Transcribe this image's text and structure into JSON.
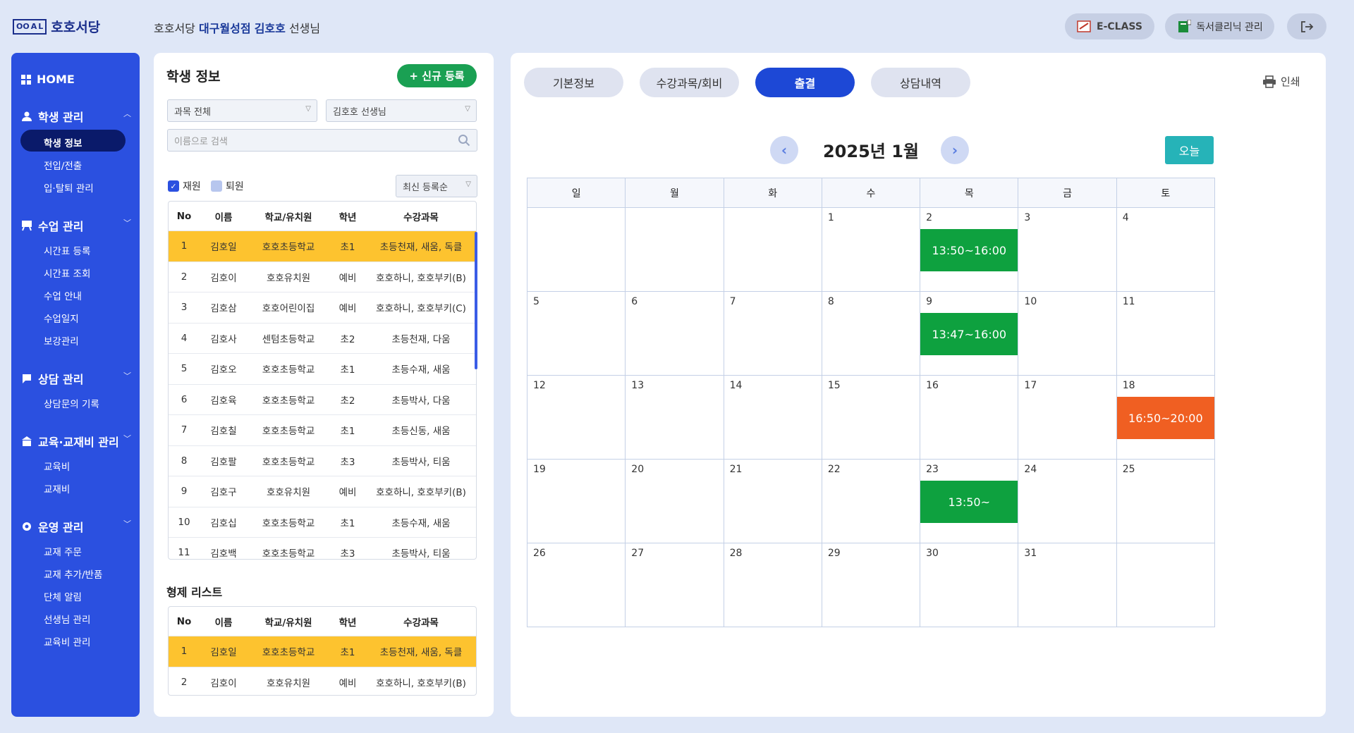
{
  "brand": {
    "mark": [
      "OO",
      "A",
      "L"
    ],
    "name": "호호서당"
  },
  "header": {
    "prefix": "호호서당",
    "branch": "대구월성점",
    "teacher": "김호호",
    "suffix": "선생님"
  },
  "header_buttons": [
    {
      "label": "E-CLASS",
      "icon": "eclass-icon"
    },
    {
      "label": "독서클리닉 관리",
      "icon": "book-icon"
    },
    {
      "label": "",
      "icon": "logout-icon"
    }
  ],
  "sidebar": {
    "home": "HOME",
    "sections": [
      {
        "label": "학생 관리",
        "icon": "person-icon",
        "expanded": true,
        "items": [
          "학생 정보",
          "전입/전출",
          "입·탈퇴 관리"
        ],
        "active": 0
      },
      {
        "label": "수업 관리",
        "icon": "easel-icon",
        "expanded": false,
        "items": [
          "시간표 등록",
          "시간표 조회",
          "수업 안내",
          "수업일지",
          "보강관리"
        ]
      },
      {
        "label": "상담 관리",
        "icon": "chat-icon",
        "expanded": false,
        "items": [
          "상담문의 기록"
        ]
      },
      {
        "label": "교육·교재비 관리",
        "icon": "school-icon",
        "expanded": false,
        "items": [
          "교육비",
          "교재비"
        ]
      },
      {
        "label": "운영 관리",
        "icon": "gear-icon",
        "expanded": false,
        "items": [
          "교재 주문",
          "교재 추가/반품",
          "단체 알림",
          "선생님 관리",
          "교육비 관리"
        ]
      }
    ]
  },
  "student_panel": {
    "title": "학생 정보",
    "new_button": "+ 신규 등록",
    "filter_subject": "과목 전체",
    "filter_teacher": "김호호 선생님",
    "search_placeholder": "이름으로 검색",
    "check_enrolled": "재원",
    "check_withdrawn": "퇴원",
    "sort": "최신 등록순",
    "columns": [
      "No",
      "이름",
      "학교/유치원",
      "학년",
      "수강과목"
    ],
    "rows": [
      [
        "1",
        "김호일",
        "호호초등학교",
        "초1",
        "초등천재, 새움, 독클"
      ],
      [
        "2",
        "김호이",
        "호호유치원",
        "예비",
        "호호하니, 호호부키(B)"
      ],
      [
        "3",
        "김호삼",
        "호호어린이집",
        "예비",
        "호호하니, 호호부키(C)"
      ],
      [
        "4",
        "김호사",
        "센텀초등학교",
        "초2",
        "초등천재, 다움"
      ],
      [
        "5",
        "김호오",
        "호호초등학교",
        "초1",
        "초등수재, 새움"
      ],
      [
        "6",
        "김호육",
        "호호초등학교",
        "초2",
        "초등박사, 다움"
      ],
      [
        "7",
        "김호칠",
        "호호초등학교",
        "초1",
        "초등신동, 새움"
      ],
      [
        "8",
        "김호팔",
        "호호초등학교",
        "초3",
        "초등박사, 티움"
      ],
      [
        "9",
        "김호구",
        "호호유치원",
        "예비",
        "호호하니, 호호부키(B)"
      ],
      [
        "10",
        "김호십",
        "호호초등학교",
        "초1",
        "초등수재, 새움"
      ],
      [
        "11",
        "김호백",
        "호호초등학교",
        "초3",
        "초등박사, 티움"
      ]
    ],
    "selected_row": 0,
    "siblings_title": "형제 리스트",
    "sibling_rows": [
      [
        "1",
        "김호일",
        "호호초등학교",
        "초1",
        "초등천재, 새움, 독클"
      ],
      [
        "2",
        "김호이",
        "호호유치원",
        "예비",
        "호호하니, 호호부키(B)"
      ]
    ]
  },
  "tabs": [
    "기본정보",
    "수강과목/회비",
    "출결",
    "상담내역"
  ],
  "active_tab": 2,
  "print_label": "인쇄",
  "calendar": {
    "title": "2025년 1월",
    "today_label": "오늘",
    "weekdays": [
      "일",
      "월",
      "화",
      "수",
      "목",
      "금",
      "토"
    ],
    "weeks": [
      [
        "",
        "",
        "",
        "1",
        "2",
        "3",
        "4"
      ],
      [
        "5",
        "6",
        "7",
        "8",
        "9",
        "10",
        "11"
      ],
      [
        "12",
        "13",
        "14",
        "15",
        "16",
        "17",
        "18"
      ],
      [
        "19",
        "20",
        "21",
        "22",
        "23",
        "24",
        "25"
      ],
      [
        "26",
        "27",
        "28",
        "29",
        "30",
        "31",
        ""
      ]
    ],
    "events": [
      {
        "day": "2",
        "time": "13:50~16:00",
        "status": "present"
      },
      {
        "day": "9",
        "time": "13:47~16:00",
        "status": "present"
      },
      {
        "day": "18",
        "time": "16:50~20:00",
        "status": "other"
      },
      {
        "day": "23",
        "time": "13:50~",
        "status": "present"
      }
    ],
    "status_colors": {
      "present": "#0ea13f",
      "other": "#f05f22"
    }
  }
}
